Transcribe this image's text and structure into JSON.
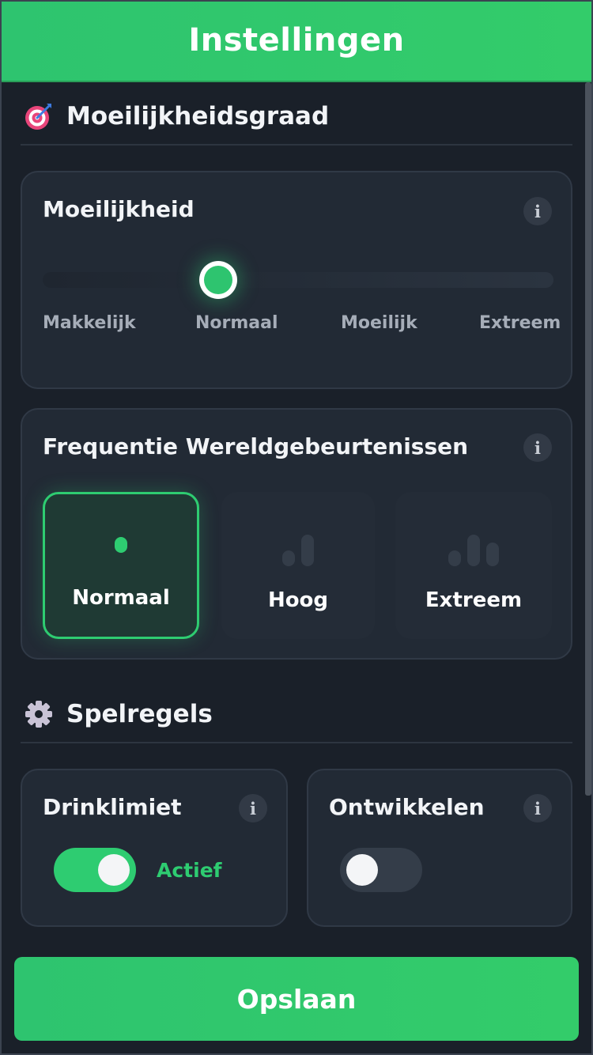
{
  "header": {
    "title": "Instellingen"
  },
  "sections": {
    "difficulty": {
      "title": "Moeilijkheidsgraad",
      "icon": "target-icon",
      "card": {
        "title": "Moeilijkheid",
        "info": "i",
        "levels": [
          "Makkelijk",
          "Normaal",
          "Moeilijk",
          "Extreem"
        ],
        "selected_level": "Normaal"
      }
    },
    "world_events": {
      "title": "Frequentie Wereldgebeurtenissen",
      "info": "i",
      "options": [
        {
          "label": "Normaal",
          "icon": "bars-1-icon",
          "active": true
        },
        {
          "label": "Hoog",
          "icon": "bars-2-icon",
          "active": false
        },
        {
          "label": "Extreem",
          "icon": "bars-3-icon",
          "active": false
        }
      ]
    },
    "rules": {
      "title": "Spelregels",
      "icon": "gear-icon",
      "drink_limit": {
        "title": "Drinklimiet",
        "info": "i",
        "enabled": true,
        "state_label": "Actief"
      },
      "develop": {
        "title": "Ontwikkelen",
        "info": "i",
        "enabled": false
      }
    }
  },
  "save_button": {
    "label": "Opslaan"
  },
  "colors": {
    "accent": "#2ecc71",
    "background": "#1a2029",
    "card": "#222a35"
  }
}
